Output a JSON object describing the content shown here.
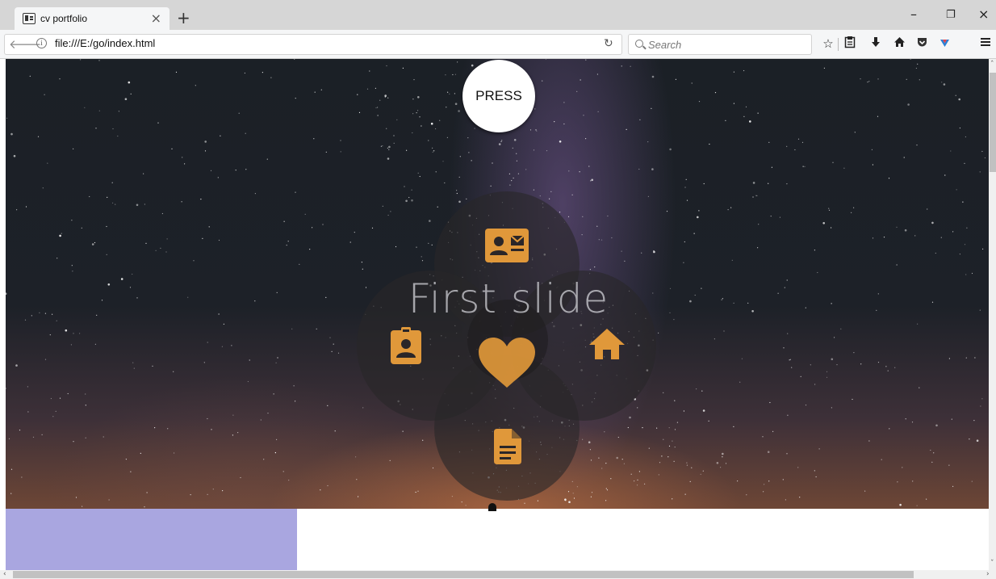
{
  "browser": {
    "tab": {
      "title": "cv portfolio",
      "close_glyph": "×",
      "favicon": "contact-card-icon"
    },
    "new_tab_glyph": "+",
    "window_controls": {
      "minimize": "–",
      "restore": "❐",
      "close": "×"
    },
    "url": "file:///E:/go/index.html",
    "search": {
      "placeholder": "Search"
    },
    "toolbar_icons": [
      "star-icon",
      "reading-list-icon",
      "download-icon",
      "home-icon",
      "pocket-icon",
      "extension-icon",
      "menu-icon"
    ]
  },
  "page": {
    "press_label": "PRESS",
    "slide_caption": "First slide",
    "menu_icons": {
      "top": "contact-card-icon",
      "left": "id-badge-icon",
      "right": "home-icon",
      "bottom": "document-icon",
      "center": "heart-icon"
    },
    "accent_color": "#e0983a",
    "footer_block_color": "#a9a6e0"
  }
}
